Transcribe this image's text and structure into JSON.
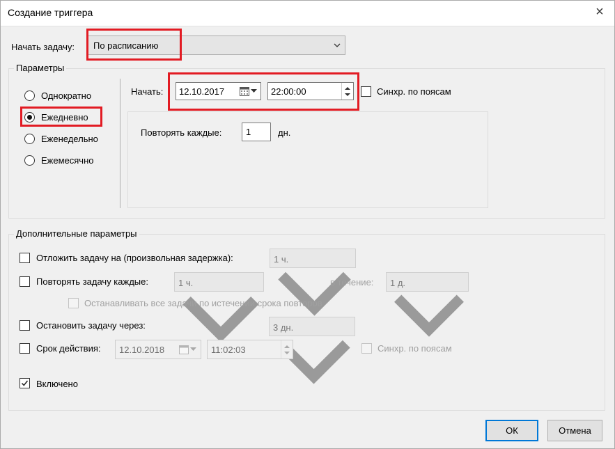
{
  "window": {
    "title": "Создание триггера",
    "close_icon": "×"
  },
  "start_task": {
    "label": "Начать задачу:",
    "value": "По расписанию"
  },
  "params": {
    "title": "Параметры",
    "radios": [
      {
        "label": "Однократно",
        "checked": false
      },
      {
        "label": "Ежедневно",
        "checked": true
      },
      {
        "label": "Еженедельно",
        "checked": false
      },
      {
        "label": "Ежемесячно",
        "checked": false
      }
    ],
    "start_label": "Начать:",
    "start_date": "12.10.2017",
    "start_time": "22:00:00",
    "sync_label": "Синхр. по поясам",
    "repeat_every_label": "Повторять каждые:",
    "repeat_every_value": "1",
    "repeat_every_unit": "дн."
  },
  "advanced": {
    "title": "Дополнительные параметры",
    "delay_label": "Отложить задачу на (произвольная задержка):",
    "delay_value": "1 ч.",
    "repeat_label": "Повторять задачу каждые:",
    "repeat_value": "1 ч.",
    "during_label": "в течение:",
    "during_value": "1 д.",
    "stop_all_label": "Останавливать все задачи по истечении срока повторов",
    "stop_after_label": "Остановить задачу через:",
    "stop_after_value": "3 дн.",
    "expire_label": "Срок действия:",
    "expire_date": "12.10.2018",
    "expire_time": "11:02:03",
    "expire_sync_label": "Синхр. по поясам",
    "enabled_label": "Включено",
    "enabled_checked": true
  },
  "buttons": {
    "ok": "ОК",
    "cancel": "Отмена"
  },
  "colors": {
    "highlight": "#e21b23",
    "accent": "#0078d7"
  }
}
